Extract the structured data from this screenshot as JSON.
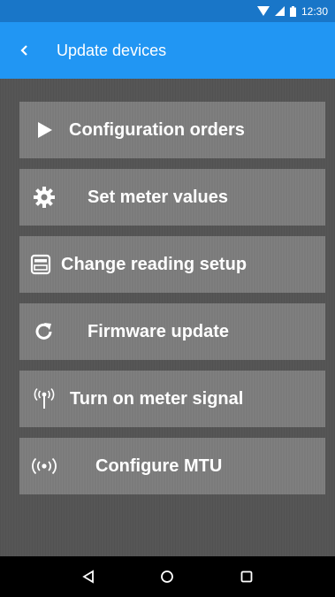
{
  "status_bar": {
    "time": "12:30",
    "icons": [
      "wifi-icon",
      "signal-icon",
      "battery-icon"
    ]
  },
  "app_bar": {
    "back_icon": "chevron-left-icon",
    "title": "Update devices"
  },
  "menu": {
    "items": [
      {
        "label": "Configuration orders",
        "icon": "play-icon"
      },
      {
        "label": "Set meter values",
        "icon": "gear-icon"
      },
      {
        "label": "Change reading setup",
        "icon": "meter-display-icon"
      },
      {
        "label": "Firmware update",
        "icon": "refresh-icon"
      },
      {
        "label": "Turn on meter signal",
        "icon": "antenna-icon"
      },
      {
        "label": "Configure MTU",
        "icon": "broadcast-icon"
      }
    ]
  },
  "nav_bar": {
    "icons": [
      "back-triangle-icon",
      "home-circle-icon",
      "recents-square-icon"
    ]
  },
  "colors": {
    "status_bar": "#1976c8",
    "app_bar": "#2196f3",
    "content_bg": "#565656",
    "button_bg": "#7b7b7b"
  }
}
